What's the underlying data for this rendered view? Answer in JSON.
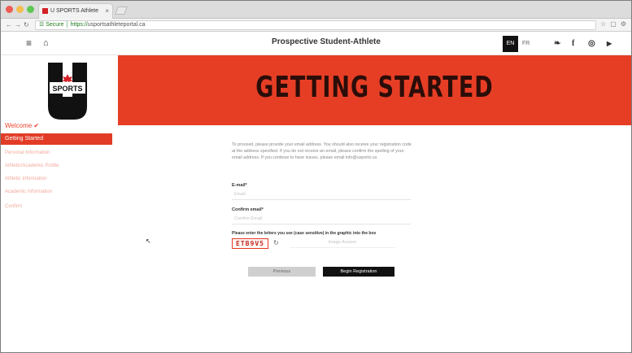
{
  "browser": {
    "tab_title": "U SPORTS Athlete",
    "tab_close": "×",
    "url_prefix": "☰ Secure │ https://",
    "url_host": "usportsathleteportal.ca",
    "nav_back": "←",
    "nav_forward": "→",
    "nav_reload": "↻",
    "right_icons": [
      "☆",
      "▢",
      "⚙"
    ]
  },
  "header": {
    "menu_icon": "≡",
    "home_icon": "⌂",
    "title": "Prospective Student-Athlete",
    "lang_active": "EN",
    "lang_other": "FR",
    "social": [
      "twitter-icon",
      "facebook-icon",
      "instagram-icon",
      "youtube-icon"
    ],
    "social_glyphs": [
      "❧",
      "f",
      "◎",
      "▶"
    ]
  },
  "logo": {
    "text": "SPORTS",
    "letter": "U"
  },
  "sidebar": {
    "welcome": "Welcome ✔",
    "active": "Getting Started",
    "items": [
      "Personal Information",
      "Athletic/Academic Profile",
      "Athletic Information",
      "Academic Information",
      "Confirm"
    ]
  },
  "banner": {
    "title": "GETTING STARTED"
  },
  "form": {
    "intro": "To proceed, please provide your email address. You should also receive your registration code at the address specified. If you do not receive an email, please confirm the spelling of your email address. If you continue to have issues, please email info@usports.ca",
    "email_label": "E-mail*",
    "email_placeholder": "Email",
    "confirm_label": "Confirm email*",
    "confirm_placeholder": "Confirm Email",
    "captcha_label": "Please enter the letters you see (case sensitive) in the graphic into the box",
    "captcha_text": "ETB9V5",
    "captcha_refresh": "↻",
    "captcha_placeholder": "Image Answer",
    "prev_button": "Previous",
    "begin_button": "Begin Registration"
  },
  "colors": {
    "accent": "#e63e25",
    "dark": "#111111"
  }
}
